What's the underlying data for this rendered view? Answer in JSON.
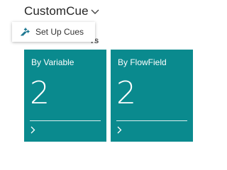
{
  "header": {
    "title": "CustomCue"
  },
  "menu": {
    "items": [
      {
        "label": "Set Up Cues",
        "icon": "setup-icon"
      }
    ]
  },
  "section": {
    "partial_label": "rs"
  },
  "tiles": [
    {
      "label": "By Variable",
      "value": "2"
    },
    {
      "label": "By FlowField",
      "value": "2"
    }
  ],
  "colors": {
    "tile_bg": "#0a8a8e",
    "menu_icon": "#0f6f8a",
    "text": "#262626"
  }
}
